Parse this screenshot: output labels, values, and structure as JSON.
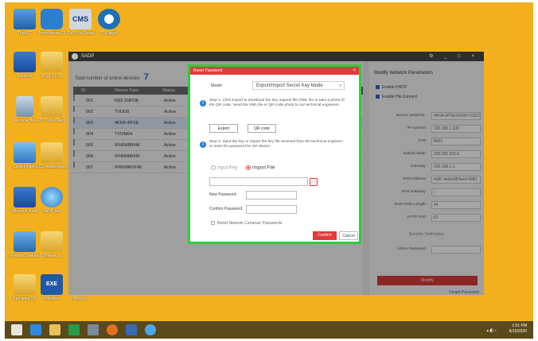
{
  "desktop": {
    "icons": [
      {
        "label": "This PC"
      },
      {
        "label": "TeamViewer 13"
      },
      {
        "label": "CMS Pro Setup"
      },
      {
        "label": "TSPlayer"
      },
      {
        "label": "Network"
      },
      {
        "label": "2018-01-03"
      },
      {
        "label": "Recycle Bin"
      },
      {
        "label": "PC Tools Client"
      },
      {
        "label": "Control Panel"
      },
      {
        "label": "VLC media player"
      },
      {
        "label": "Hikvision Tools"
      },
      {
        "label": "SADP tool"
      },
      {
        "label": "Remote Desktop"
      },
      {
        "label": "TSPlayer_s..."
      },
      {
        "label": "Firmware V5"
      },
      {
        "label": "Hikvision"
      },
      {
        "label": "HiSilicon..."
      }
    ]
  },
  "sadp": {
    "title": "SADP",
    "online_label": "Total number of online devices:",
    "online_count": "7",
    "columns": {
      "id": "ID",
      "device_type": "Device Type",
      "status": "Status"
    },
    "rows": [
      {
        "id": "001",
        "type": "N33-1NPOE",
        "status": "Active"
      },
      {
        "id": "002",
        "type": "TVDG8",
        "status": "Active"
      },
      {
        "id": "003",
        "type": "4KN4-4POE",
        "status": "Active"
      },
      {
        "id": "004",
        "type": "TVI2M64",
        "status": "Active"
      },
      {
        "id": "005",
        "type": "IPH6M8B4M",
        "status": "Active"
      },
      {
        "id": "006",
        "type": "IPH6M8B4M",
        "status": "Active"
      },
      {
        "id": "007",
        "type": "IPR5MMVFIR",
        "status": "Active"
      }
    ]
  },
  "params": {
    "title": "Modify Network Parameters",
    "enable_dhcp": "Enable DHCP",
    "enable_hik": "Enable Hik-Connect",
    "fields": [
      {
        "key": "Device Serial No.:",
        "value": "4KN4-4POE0420571031C1"
      },
      {
        "key": "IP Address:",
        "value": "192.168.1.108"
      },
      {
        "key": "Port:",
        "value": "8001"
      },
      {
        "key": "Subnet Mask:",
        "value": "255.255.255.0"
      },
      {
        "key": "Gateway:",
        "value": "192.168.1.1"
      },
      {
        "key": "IPv6 Address:",
        "value": "fe80::4ebd:8ff:feed:4980"
      },
      {
        "key": "IPv6 Gateway:",
        "value": "::"
      },
      {
        "key": "IPv6 Prefix Length:",
        "value": "64"
      },
      {
        "key": "HTTP Port:",
        "value": "81"
      }
    ],
    "security_verification": "Security Verification",
    "admin_password": "Admin Password:",
    "modify": "Modify",
    "forgot": "Forgot Password"
  },
  "dialog": {
    "title": "Reset Password",
    "close": "×",
    "mode_label": "Mode:",
    "mode_value": "Export/Import Secret Key Mode",
    "step1": "Step 1: Click Export to download the key request file (XML file or take a photo of the QR code. Send the XML file or QR code photo to our technical engineers.",
    "export": "Export",
    "qr_code": "QR code",
    "step2": "Step 2: Input the key or import the key file received from the technical engineer to reset the password for the device.",
    "input_key": "Input Key",
    "import_file": "Import File",
    "new_password": "New Password:",
    "confirm_password": "Confirm Password:",
    "reset_network": "Reset Network Cameras' Passwords",
    "confirm": "Confirm",
    "cancel": "Cancel"
  },
  "taskbar": {
    "time": "1:51 PM",
    "date": "6/15/2020"
  }
}
